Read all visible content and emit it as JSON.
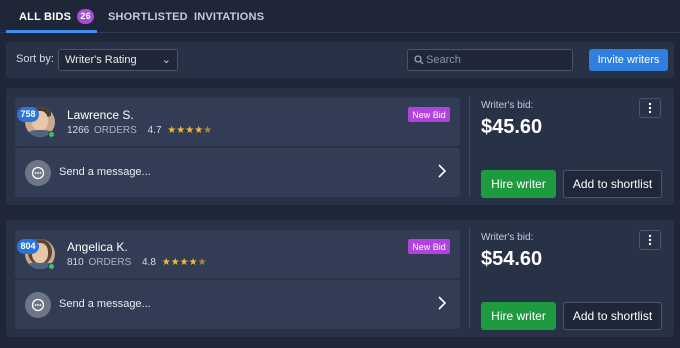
{
  "tabs": [
    {
      "label": "ALL BIDS",
      "count": "26",
      "active": true
    },
    {
      "label": "SHORTLISTED"
    },
    {
      "label": "INVITATIONS"
    }
  ],
  "toolbar": {
    "sort_label": "Sort by:",
    "sort_value": "Writer's Rating",
    "search_placeholder": "Search",
    "search_value": "",
    "invite_label": "Invite writers"
  },
  "bids": [
    {
      "rating_badge": "758",
      "name": "Lawrence S.",
      "orders": "1266",
      "orders_label": "ORDERS",
      "score": "4.7",
      "stars": 4.7,
      "new_bid_label": "New Bid",
      "message_placeholder": "Send a message...",
      "bid_label": "Writer's bid:",
      "bid_amount": "$45.60",
      "hire_label": "Hire writer",
      "shortlist_label": "Add to shortlist",
      "online": true
    },
    {
      "rating_badge": "804",
      "name": "Angelica K.",
      "orders": "810",
      "orders_label": "ORDERS",
      "score": "4.8",
      "stars": 4.8,
      "new_bid_label": "New Bid",
      "message_placeholder": "Send a message...",
      "bid_label": "Writer's bid:",
      "bid_amount": "$54.60",
      "hire_label": "Hire writer",
      "shortlist_label": "Add to shortlist",
      "online": true
    }
  ],
  "colors": {
    "accent": "#2f7fe0",
    "hire": "#1e9a41",
    "new_bid": "#b042dd",
    "star": "#f5b92e",
    "online": "#3cc168"
  }
}
